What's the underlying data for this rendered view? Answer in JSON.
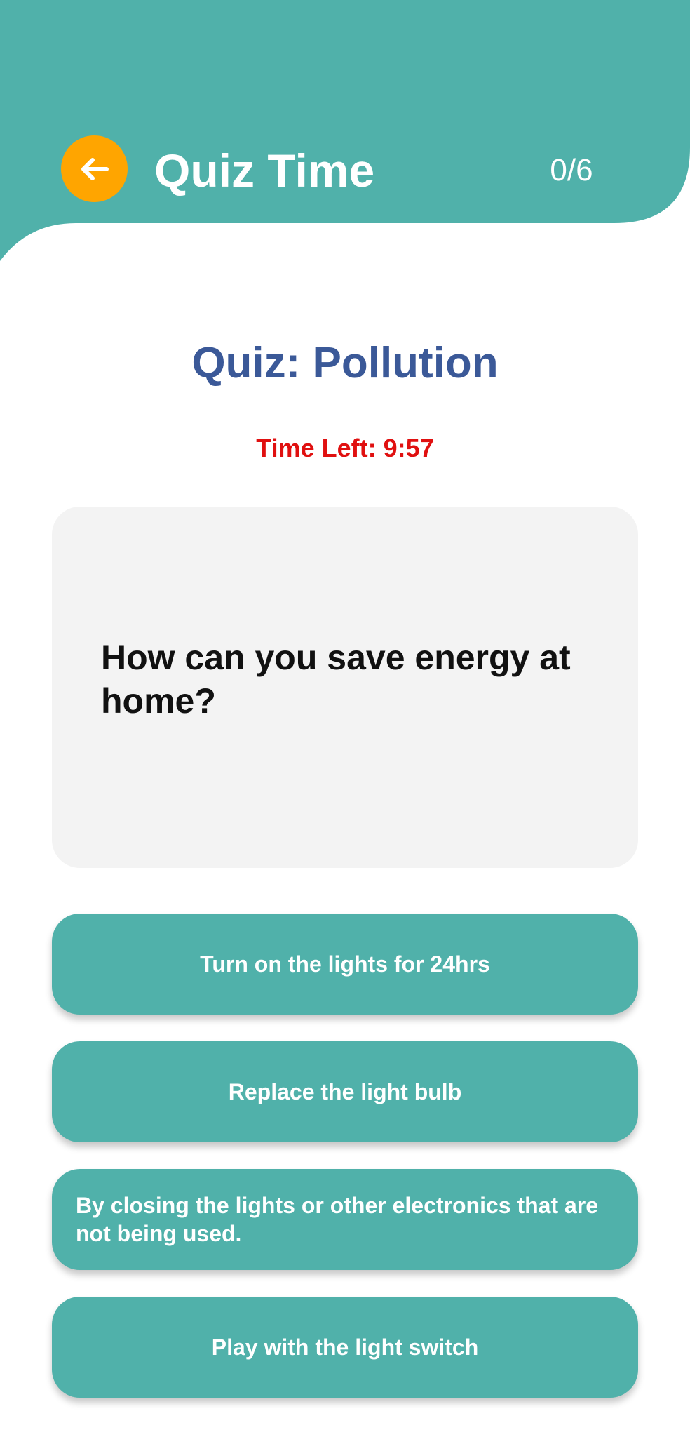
{
  "header": {
    "title": "Quiz Time",
    "progress": "0/6",
    "back_icon": "arrow-left-icon",
    "bg_color": "#50B1AA",
    "back_color": "#FFA500"
  },
  "quiz": {
    "title": "Quiz: Pollution",
    "timer": "Time Left: 9:57",
    "question": "How can you save energy at home?",
    "answers": [
      {
        "label": "Turn on the lights for 24hrs"
      },
      {
        "label": "Replace the light bulb"
      },
      {
        "label": "By closing the lights or other electronics that are not being used."
      },
      {
        "label": "Play with the light switch"
      }
    ]
  },
  "colors": {
    "title": "#3B5998",
    "timer": "#E01010",
    "card_bg": "#F3F3F3",
    "answer_bg": "#50B1AA"
  }
}
